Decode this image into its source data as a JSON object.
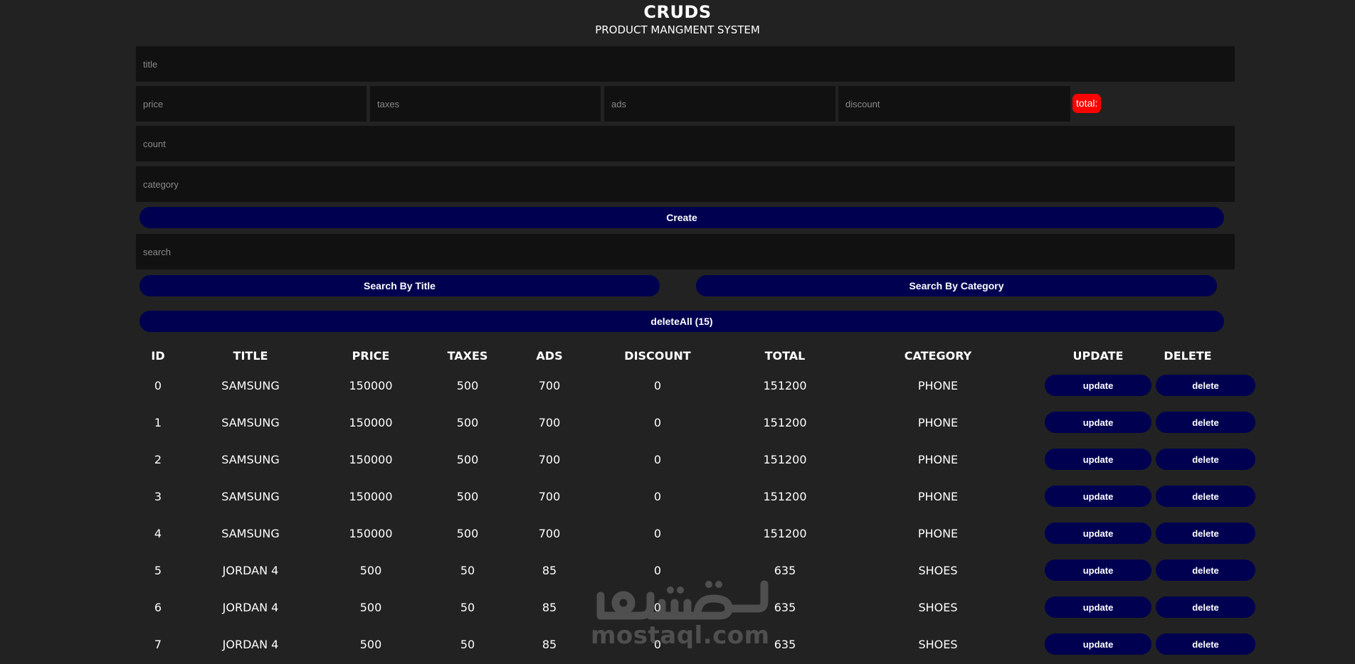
{
  "header": {
    "title": "CRUDS",
    "subtitle": "PRODUCT MANGMENT SYSTEM"
  },
  "form": {
    "title_placeholder": "title",
    "price_placeholder": "price",
    "taxes_placeholder": "taxes",
    "ads_placeholder": "ads",
    "discount_placeholder": "discount",
    "total_label": "total:",
    "count_placeholder": "count",
    "category_placeholder": "category",
    "create_label": "Create"
  },
  "search": {
    "placeholder": "search",
    "by_title_label": "Search By Title",
    "by_category_label": "Search By Category"
  },
  "delete_all_label": "deleteAll (15)",
  "table": {
    "headers": [
      "ID",
      "TITLE",
      "PRICE",
      "TAXES",
      "ADS",
      "DISCOUNT",
      "TOTAL",
      "CATEGORY",
      "UPDATE",
      "DELETE"
    ],
    "update_label": "update",
    "delete_label": "delete",
    "rows": [
      {
        "id": "0",
        "title": "SAMSUNG",
        "price": "150000",
        "taxes": "500",
        "ads": "700",
        "discount": "0",
        "total": "151200",
        "category": "PHONE"
      },
      {
        "id": "1",
        "title": "SAMSUNG",
        "price": "150000",
        "taxes": "500",
        "ads": "700",
        "discount": "0",
        "total": "151200",
        "category": "PHONE"
      },
      {
        "id": "2",
        "title": "SAMSUNG",
        "price": "150000",
        "taxes": "500",
        "ads": "700",
        "discount": "0",
        "total": "151200",
        "category": "PHONE"
      },
      {
        "id": "3",
        "title": "SAMSUNG",
        "price": "150000",
        "taxes": "500",
        "ads": "700",
        "discount": "0",
        "total": "151200",
        "category": "PHONE"
      },
      {
        "id": "4",
        "title": "SAMSUNG",
        "price": "150000",
        "taxes": "500",
        "ads": "700",
        "discount": "0",
        "total": "151200",
        "category": "PHONE"
      },
      {
        "id": "5",
        "title": "JORDAN 4",
        "price": "500",
        "taxes": "50",
        "ads": "85",
        "discount": "0",
        "total": "635",
        "category": "SHOES"
      },
      {
        "id": "6",
        "title": "JORDAN 4",
        "price": "500",
        "taxes": "50",
        "ads": "85",
        "discount": "0",
        "total": "635",
        "category": "SHOES"
      },
      {
        "id": "7",
        "title": "JORDAN 4",
        "price": "500",
        "taxes": "50",
        "ads": "85",
        "discount": "0",
        "total": "635",
        "category": "SHOES"
      }
    ]
  },
  "watermark": {
    "arabic": "مستقل",
    "latin": "mostaql.com"
  },
  "colors": {
    "background": "#222222",
    "input_background": "#111111",
    "button": "#000050",
    "total_badge": "#ff0000"
  }
}
